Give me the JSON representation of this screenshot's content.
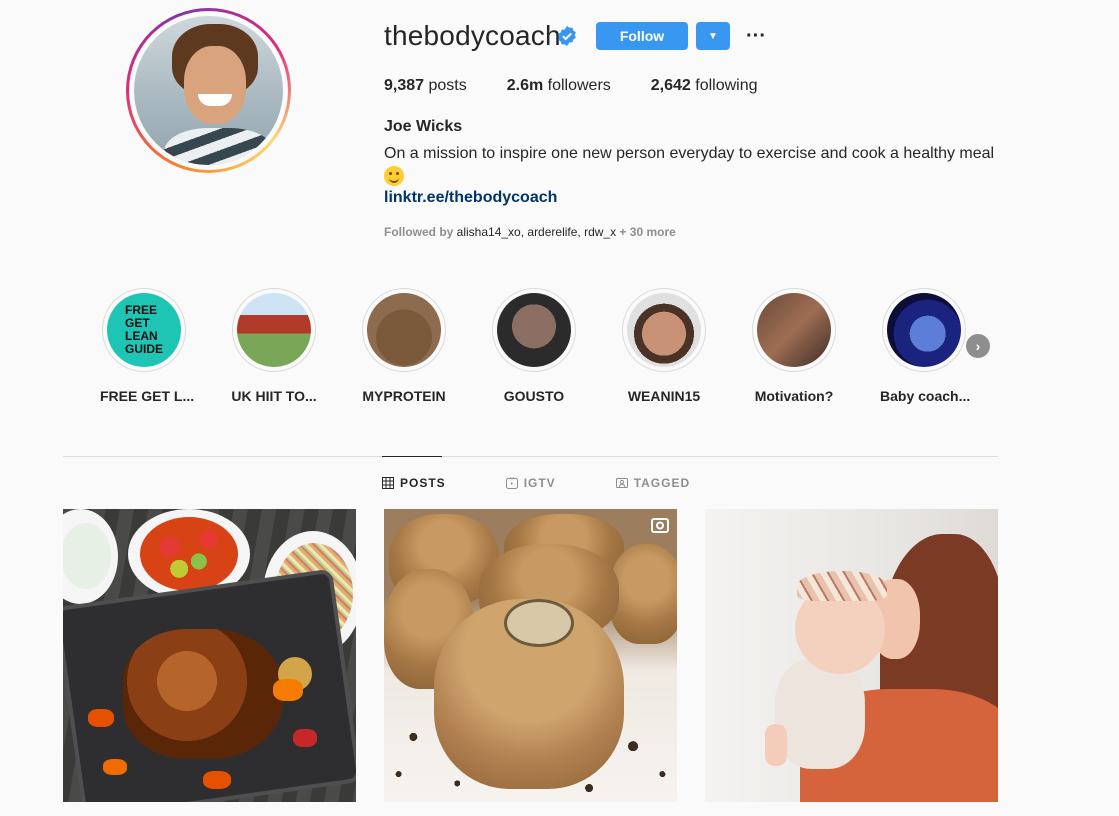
{
  "profile": {
    "username": "thebodycoach",
    "verified": true,
    "follow_label": "Follow",
    "dropdown_icon": "▼",
    "more_icon": "···",
    "stats": {
      "posts_count": "9,387",
      "posts_label": " posts",
      "followers_count": "2.6m",
      "followers_label": " followers",
      "following_count": "2,642",
      "following_label": " following"
    },
    "full_name": "Joe Wicks",
    "bio": "On a mission to inspire one new person everyday to exercise and cook a healthy meal",
    "link": "linktr.ee/thebodycoach",
    "followed_by_prefix": "Followed by ",
    "followed_by_names": "alisha14_xo, arderelife, rdw_x",
    "followed_by_more": " + 30 more"
  },
  "highlights": [
    {
      "label": "FREE GET L...",
      "cover_text": [
        "FREE",
        "GET",
        "LEAN",
        "GUIDE"
      ]
    },
    {
      "label": "UK HIIT TO..."
    },
    {
      "label": "MYPROTEIN"
    },
    {
      "label": "GOUSTO"
    },
    {
      "label": "WEANIN15"
    },
    {
      "label": "Motivation?"
    },
    {
      "label": "Baby coach..."
    }
  ],
  "highlights_next_icon": "›",
  "tabs": [
    {
      "label": "POSTS",
      "icon": "grid-icon",
      "active": true
    },
    {
      "label": "IGTV",
      "icon": "igtv-icon",
      "active": false
    },
    {
      "label": "TAGGED",
      "icon": "tagged-icon",
      "active": false
    }
  ],
  "colors": {
    "accent_blue": "#3897f0",
    "link_blue": "#003569",
    "text": "#262626",
    "muted": "#8e8e8e",
    "background": "#fafafa"
  }
}
